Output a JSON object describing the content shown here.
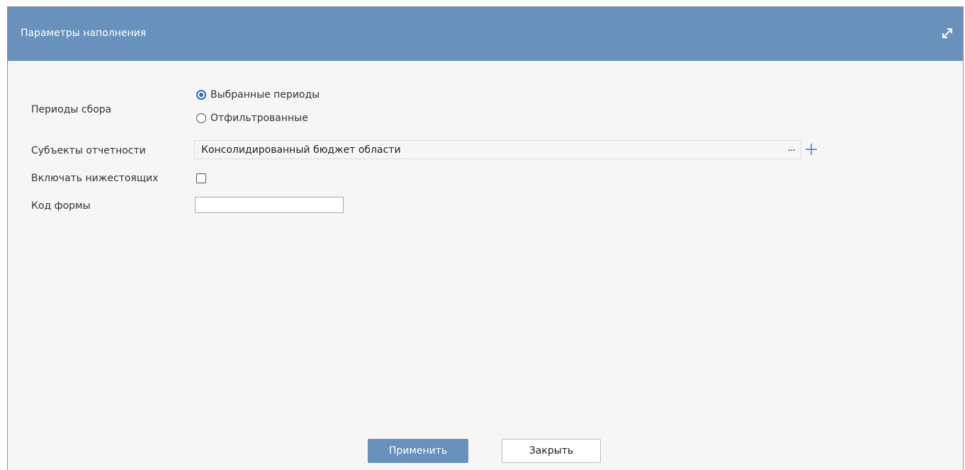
{
  "dialog": {
    "title": "Параметры наполнения"
  },
  "fields": {
    "collection_periods": {
      "label": "Периоды сбора",
      "options": [
        "Выбранные периоды",
        "Отфильтрованные"
      ],
      "selected": "Выбранные периоды"
    },
    "reporting_subjects": {
      "label": "Субъекты отчетности",
      "value": "Консолидированный бюджет области",
      "browse_label": "..."
    },
    "include_subordinates": {
      "label": "Включать нижестоящих",
      "checked": false
    },
    "form_code": {
      "label": "Код формы",
      "value": ""
    }
  },
  "buttons": {
    "apply": "Применить",
    "close": "Закрыть"
  },
  "icons": {
    "maximize": "maximize-icon",
    "add": "plus-icon"
  },
  "colors": {
    "header": "#6891bb",
    "accent": "#2a6bc7"
  }
}
